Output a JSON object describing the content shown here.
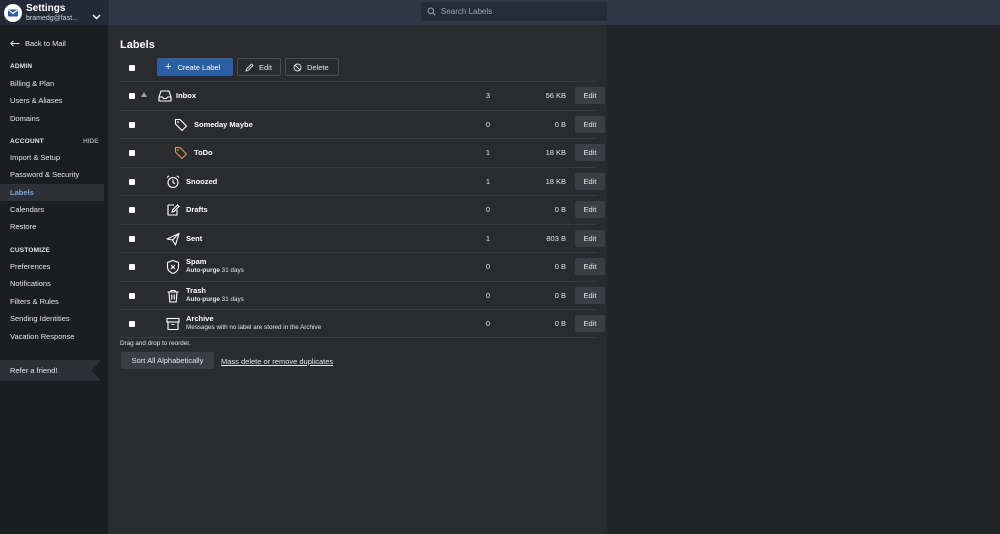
{
  "header": {
    "app_title": "Settings",
    "account": "bramedg@fast...",
    "search_placeholder": "Search Labels"
  },
  "sidebar": {
    "back_label": "Back to Mail",
    "sections": {
      "admin": "ADMIN",
      "account": "ACCOUNT",
      "account_hide": "HIDE",
      "customize": "CUSTOMIZE"
    },
    "admin_items": [
      "Billing & Plan",
      "Users & Aliases",
      "Domains"
    ],
    "account_items": [
      "Import & Setup",
      "Password & Security",
      "Labels",
      "Calendars",
      "Restore"
    ],
    "customize_items": [
      "Preferences",
      "Notifications",
      "Filters & Rules",
      "Sending Identities",
      "Vacation Response"
    ],
    "active_item": "Labels",
    "refer_label": "Refer a friend!"
  },
  "main": {
    "title": "Labels",
    "toolbar": {
      "create_label": "Create Label",
      "edit_label": "Edit",
      "delete_label": "Delete"
    },
    "labels": [
      {
        "name": "Inbox",
        "icon": "inbox-icon",
        "count": "3",
        "size": "56 KB",
        "edit": "Edit"
      },
      {
        "name": "Someday Maybe",
        "icon": "tag-icon",
        "count": "0",
        "size": "0 B",
        "edit": "Edit"
      },
      {
        "name": "ToDo",
        "icon": "tag-icon",
        "count": "1",
        "size": "18 KB",
        "edit": "Edit"
      },
      {
        "name": "Snoozed",
        "icon": "alarm-clock-icon",
        "count": "1",
        "size": "18 KB",
        "edit": "Edit"
      },
      {
        "name": "Drafts",
        "icon": "drafts-icon",
        "count": "0",
        "size": "0 B",
        "edit": "Edit"
      },
      {
        "name": "Sent",
        "icon": "send-icon",
        "count": "1",
        "size": "803 B",
        "edit": "Edit"
      },
      {
        "name": "Spam",
        "icon": "spam-shield-icon",
        "sub_bold": "Auto-purge",
        "sub_rest": " 31 days",
        "count": "0",
        "size": "0 B",
        "edit": "Edit"
      },
      {
        "name": "Trash",
        "icon": "trash-icon",
        "sub_bold": "Auto-purge",
        "sub_rest": " 31 days",
        "count": "0",
        "size": "0 B",
        "edit": "Edit"
      },
      {
        "name": "Archive",
        "icon": "archive-icon",
        "sub_rest": "Messages with no label are stored in the Archive",
        "count": "0",
        "size": "0 B",
        "edit": "Edit"
      }
    ],
    "hint": "Drag and drop to reorder.",
    "sort_label": "Sort All Alphabetically",
    "mass_delete_label": "Mass delete or remove duplicates"
  },
  "colors": {
    "accent": "#2a5fa3",
    "active_sidebar_text": "#7ea6df",
    "todo_tag": "#d99a5b"
  }
}
